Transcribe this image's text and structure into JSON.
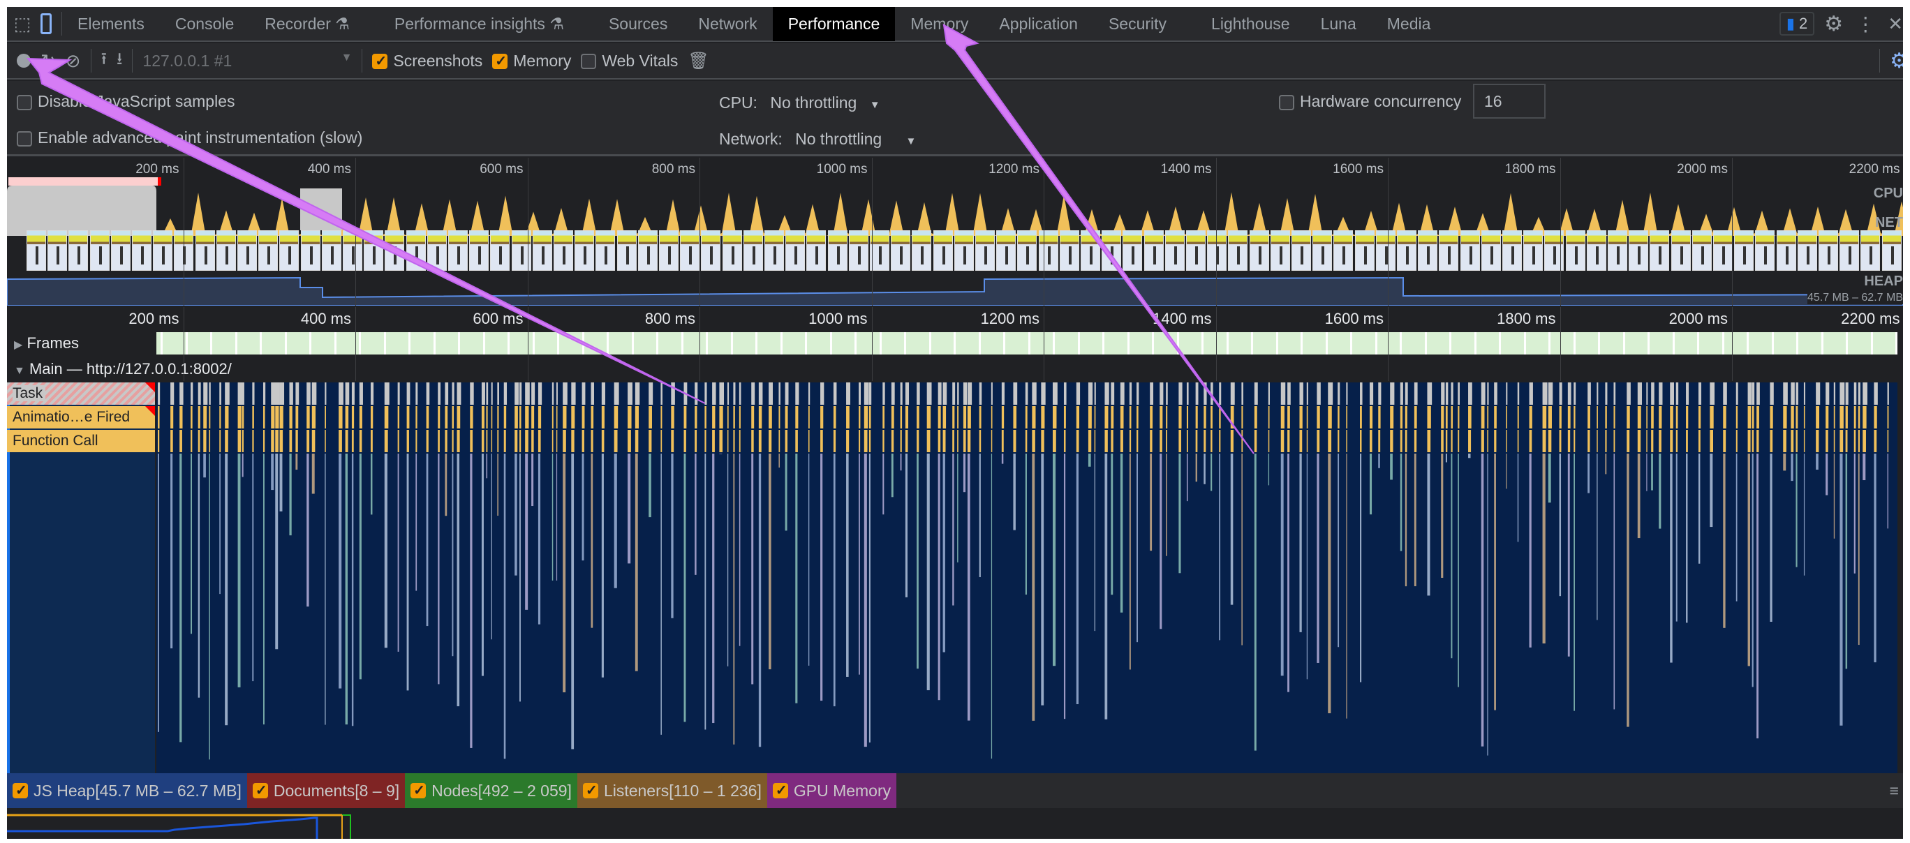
{
  "tabs": [
    "Elements",
    "Console",
    "Recorder",
    "Performance insights",
    "Sources",
    "Network",
    "Performance",
    "Memory",
    "Application",
    "Security",
    "Lighthouse",
    "Luna",
    "Media"
  ],
  "active_tab": "Performance",
  "experimental_tabs": [
    "Recorder",
    "Performance insights"
  ],
  "issues_badge": "2",
  "toolbar": {
    "target": "127.0.0.1 #1",
    "screenshots_label": "Screenshots",
    "screenshots_checked": true,
    "memory_label": "Memory",
    "memory_checked": true,
    "web_vitals_label": "Web Vitals",
    "web_vitals_checked": false
  },
  "settings": {
    "disable_js_samples": "Disable JavaScript samples",
    "advanced_paint": "Enable advanced paint instrumentation (slow)",
    "cpu_label": "CPU:",
    "cpu_value": "No throttling",
    "network_label": "Network:",
    "network_value": "No throttling",
    "hw_label": "Hardware concurrency",
    "hw_value": "16"
  },
  "overview": {
    "ticks": [
      "200 ms",
      "400 ms",
      "600 ms",
      "800 ms",
      "1000 ms",
      "1200 ms",
      "1400 ms",
      "1600 ms",
      "1800 ms",
      "2000 ms",
      "2200 ms"
    ],
    "cpu_label": "CPU",
    "net_label": "NET",
    "heap_label": "HEAP",
    "heap_range": "45.7 MB – 62.7 MB"
  },
  "main_ruler": {
    "ticks": [
      "200 ms",
      "400 ms",
      "600 ms",
      "800 ms",
      "1000 ms",
      "1200 ms",
      "1400 ms",
      "1600 ms",
      "1800 ms",
      "2000 ms",
      "2200 ms"
    ]
  },
  "tracks": {
    "frames": "Frames",
    "main": "Main — http://127.0.0.1:8002/",
    "rows": [
      "Task",
      "Animatio…e Fired",
      "Function Call"
    ]
  },
  "counters": [
    {
      "label": "JS Heap[45.7 MB – 62.7 MB]",
      "color": "#1f3f7f",
      "checked": true
    },
    {
      "label": "Documents[8 – 9]",
      "color": "#7f2424",
      "checked": true
    },
    {
      "label": "Nodes[492 – 2 059]",
      "color": "#2b7a2b",
      "checked": true
    },
    {
      "label": "Listeners[110 – 1 236]",
      "color": "#7f5a2a",
      "checked": true
    },
    {
      "label": "GPU Memory",
      "color": "#7f2a7f",
      "checked": true
    }
  ],
  "colors": {
    "cpu_scripting": "#f0c05a",
    "task": "#c8c8c8",
    "function": "#f0c05a",
    "flame_bg": "#06204a",
    "annotation": "#d67cf5",
    "frames": "#d9f0d3"
  }
}
